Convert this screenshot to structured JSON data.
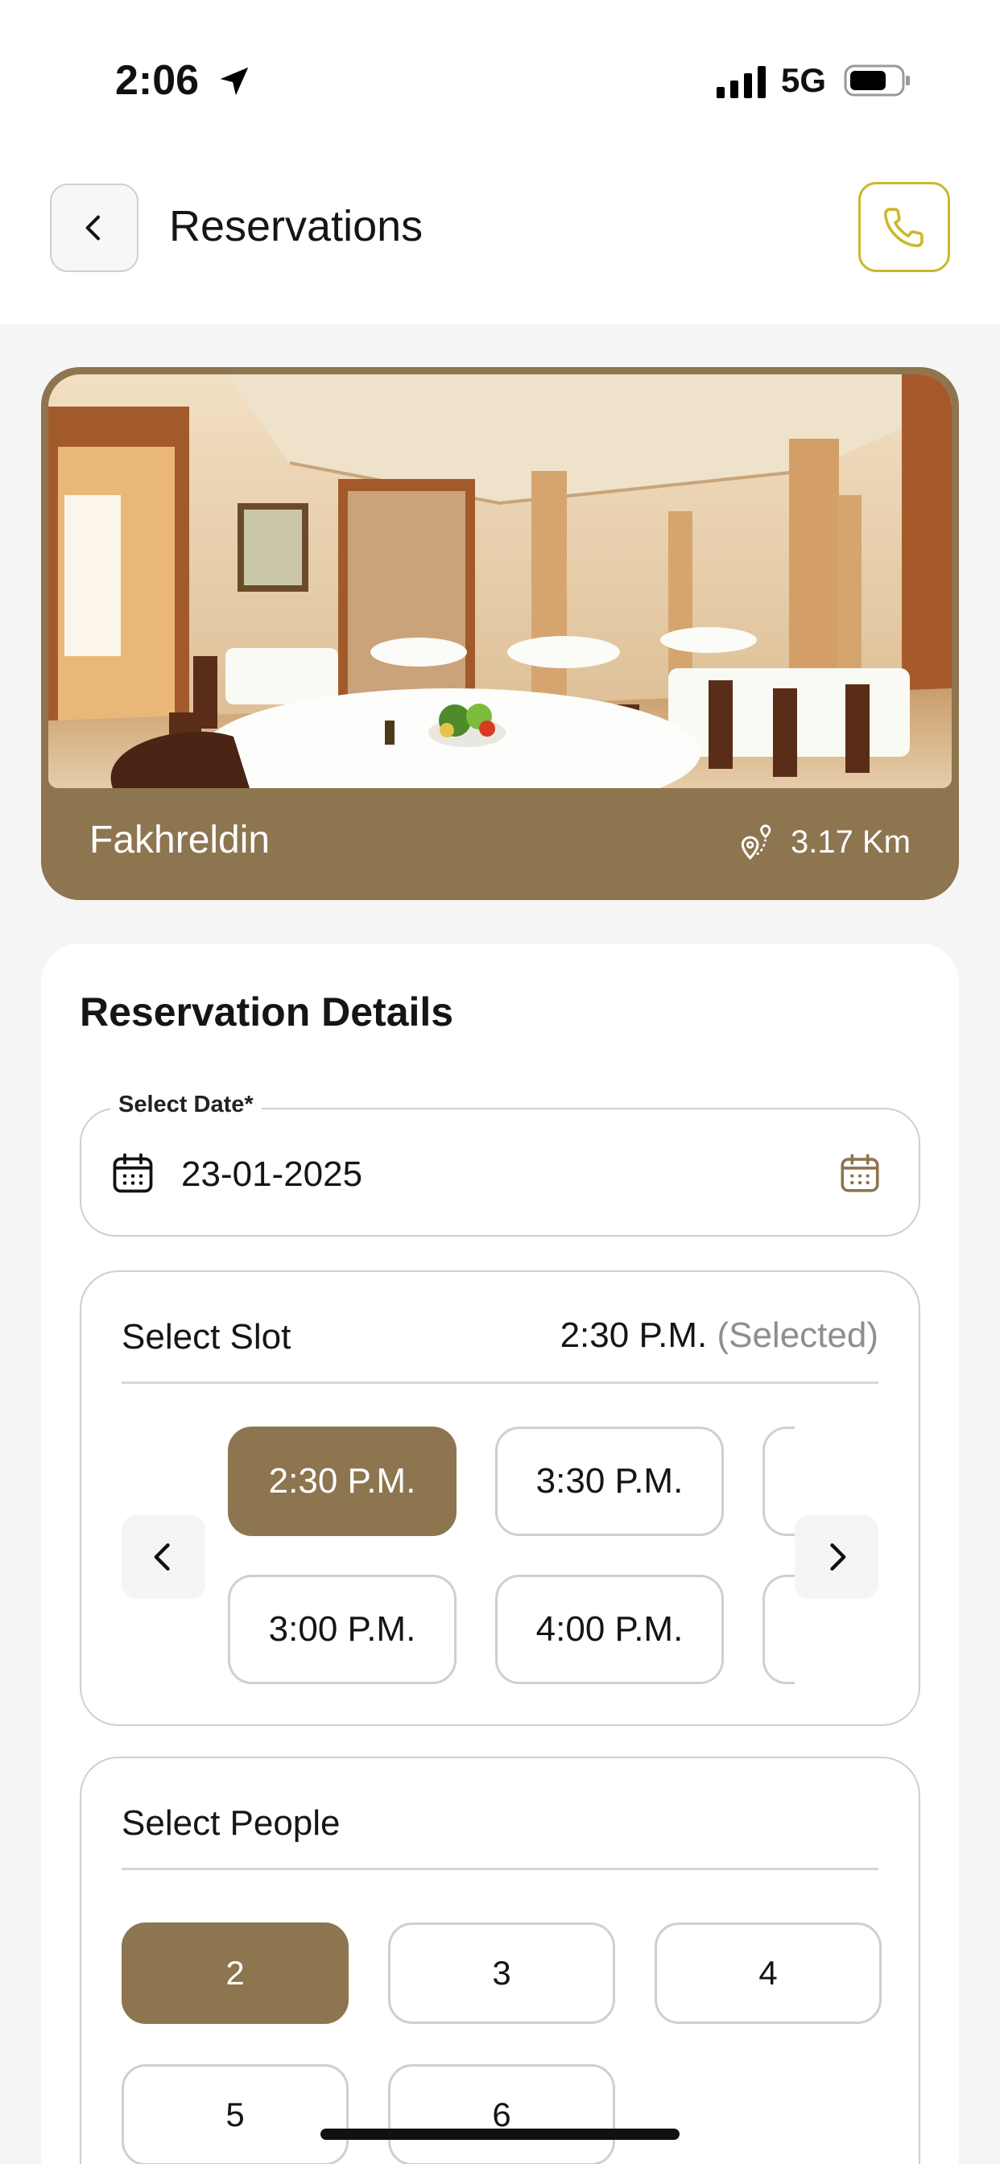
{
  "status_bar": {
    "time": "2:06",
    "network": "5G"
  },
  "header": {
    "title": "Reservations"
  },
  "restaurant": {
    "name": "Fakhreldin",
    "distance": "3.17 Km"
  },
  "details": {
    "title": "Reservation Details",
    "date": {
      "label": "Select Date*",
      "value": "23-01-2025"
    },
    "slot": {
      "label": "Select Slot",
      "selected_time": "2:30 P.M.",
      "selected_tag": "(Selected)",
      "options": [
        "2:30 P.M.",
        "3:30 P.M.",
        "3:00 P.M.",
        "4:00 P.M."
      ],
      "active_index": 0
    },
    "people": {
      "label": "Select People",
      "options": [
        "2",
        "3",
        "4",
        "5",
        "6"
      ],
      "active_index": 0
    }
  },
  "colors": {
    "accent": "#8d7550",
    "call_border": "#c9b82b"
  },
  "icons": {
    "back": "chevron-left-icon",
    "call": "phone-icon",
    "distance": "map-pin-route-icon",
    "date": "calendar-icon",
    "prev": "chevron-left-icon",
    "next": "chevron-right-icon"
  }
}
